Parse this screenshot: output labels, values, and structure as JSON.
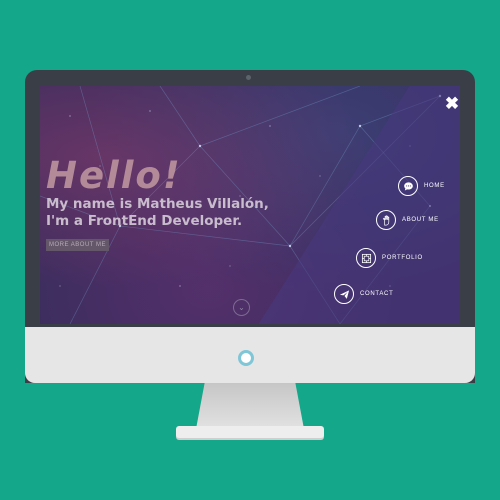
{
  "hero": {
    "title": "Hello!",
    "subtitle_line1": "My name is Matheus Villalón,",
    "subtitle_line2": "I'm a FrontEnd Developer.",
    "cta_label": "MORE ABOUT ME"
  },
  "menu": {
    "items": [
      {
        "label": "HOME",
        "icon": "chat-icon"
      },
      {
        "label": "ABOUT ME",
        "icon": "hand-icon"
      },
      {
        "label": "PORTFOLIO",
        "icon": "portfolio-icon"
      },
      {
        "label": "CONTACT",
        "icon": "paper-plane-icon"
      }
    ],
    "close_icon": "close-icon"
  },
  "colors": {
    "background": "#14a78a",
    "bezel": "#3a3f47",
    "screen": "#3a2d5d",
    "title": "#b38b98"
  }
}
